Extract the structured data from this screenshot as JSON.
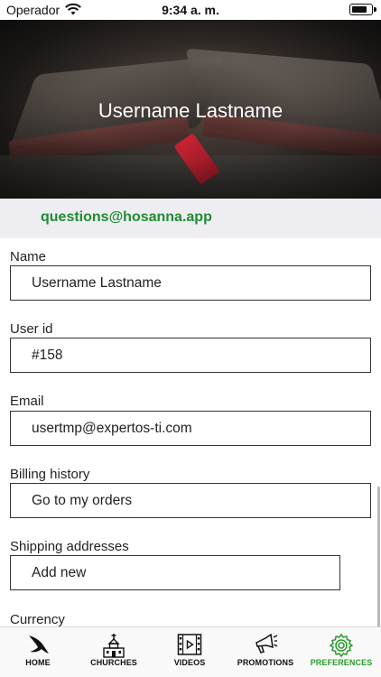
{
  "status_bar": {
    "carrier": "Operador",
    "time": "9:34 a. m."
  },
  "header": {
    "user_name": "Username Lastname",
    "support_email": "questions@hosanna.app"
  },
  "form": {
    "fields": [
      {
        "label": "Name",
        "value": "Username Lastname"
      },
      {
        "label": "User id",
        "value": "#158"
      },
      {
        "label": "Email",
        "value": "usertmp@expertos-ti.com"
      },
      {
        "label": "Billing history",
        "value": "Go to my orders"
      },
      {
        "label": "Shipping addresses",
        "value": "Add new"
      },
      {
        "label": "Currency",
        "value": ""
      }
    ]
  },
  "tab_bar": {
    "active": "PREFERENCES",
    "accent_color": "#2a9a2a",
    "tabs": [
      {
        "label": "HOME",
        "icon": "dove-icon"
      },
      {
        "label": "CHURCHES",
        "icon": "church-icon"
      },
      {
        "label": "VIDEOS",
        "icon": "film-icon"
      },
      {
        "label": "PROMOTIONS",
        "icon": "megaphone-icon"
      },
      {
        "label": "PREFERENCES",
        "icon": "gear-icon"
      }
    ]
  }
}
